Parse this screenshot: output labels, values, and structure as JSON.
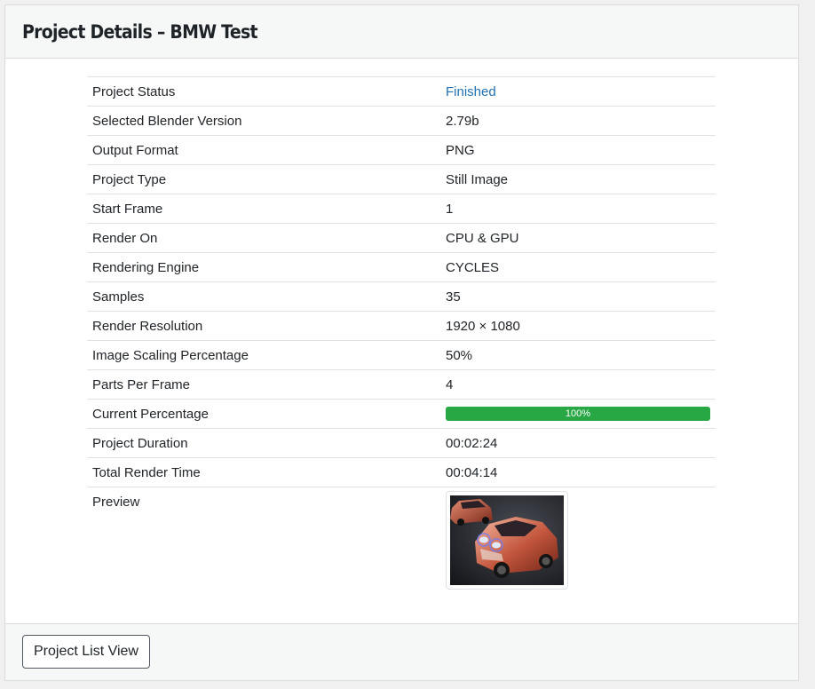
{
  "header": {
    "title": "Project Details – BMW Test"
  },
  "details": {
    "rows": [
      {
        "label": "Project Status",
        "value": "Finished"
      },
      {
        "label": "Selected Blender Version",
        "value": "2.79b"
      },
      {
        "label": "Output Format",
        "value": "PNG"
      },
      {
        "label": "Project Type",
        "value": "Still Image"
      },
      {
        "label": "Start Frame",
        "value": "1"
      },
      {
        "label": "Render On",
        "value": "CPU & GPU"
      },
      {
        "label": "Rendering Engine",
        "value": "CYCLES"
      },
      {
        "label": "Samples",
        "value": "35"
      },
      {
        "label": "Render Resolution",
        "value": "1920 × 1080"
      },
      {
        "label": "Image Scaling Percentage",
        "value": "50%"
      },
      {
        "label": "Parts Per Frame",
        "value": "4"
      },
      {
        "label": "Current Percentage",
        "value": "100%",
        "progress": 1.0
      },
      {
        "label": "Project Duration",
        "value": "00:02:24"
      },
      {
        "label": "Total Render Time",
        "value": "00:04:14"
      },
      {
        "label": "Preview",
        "value": ""
      }
    ]
  },
  "footer": {
    "button_label": "Project List View"
  },
  "colors": {
    "status_link": "#2271b1",
    "progress_fill": "#28a745",
    "header_bg": "#f6f7f7"
  },
  "icons": {
    "preview": "car-render-thumbnail"
  }
}
